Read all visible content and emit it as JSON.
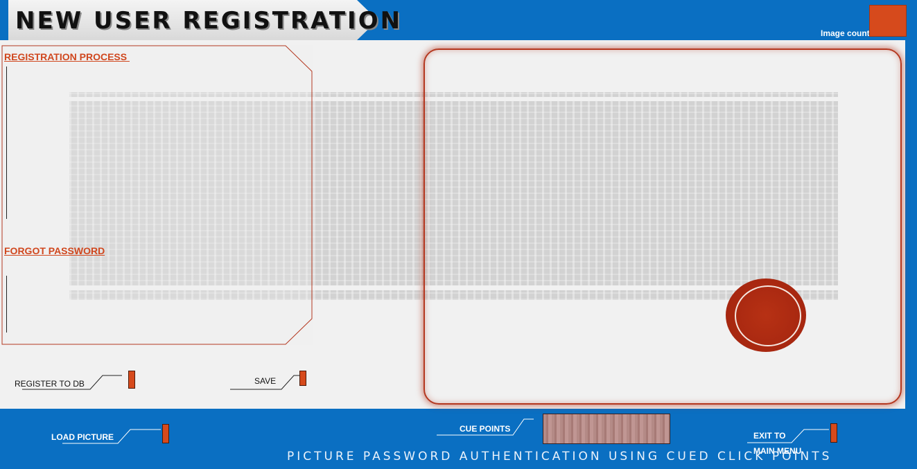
{
  "header": {
    "title": "NEW USER REGISTRATION",
    "image_count_label": "Image count"
  },
  "left_panel": {
    "registration_process": "REGISTRATION PROCESS ",
    "forgot_password": "FORGOT PASSWORD"
  },
  "buttons": {
    "register_to_db": "REGISTER TO DB",
    "save": "SAVE",
    "load_picture": "LOAD PICTURE",
    "cue_points": "CUE POINTS",
    "exit_line1": "EXIT TO",
    "exit_line2": "MAIN MENU"
  },
  "footer": {
    "tagline": "PICTURE PASSWORD AUTHENTICATION USING CUED CLICK POINTS"
  },
  "colors": {
    "brand_blue": "#0a6fc2",
    "accent_orange": "#d64a1c",
    "frame_red": "#b4371f",
    "panel_gray": "#f1f1f1"
  }
}
